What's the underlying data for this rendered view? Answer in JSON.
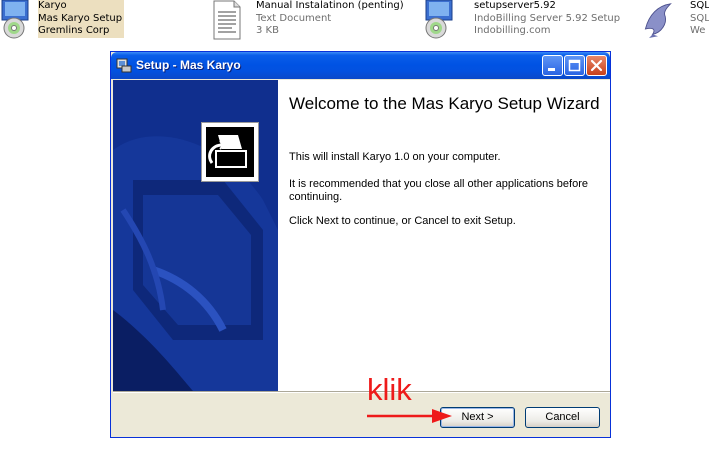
{
  "desktop": {
    "files": [
      {
        "name": "Karyo",
        "line2": "Mas Karyo Setup",
        "line3": "Gremlins Corp",
        "icon": "installer-cd-icon"
      },
      {
        "name": "Manual Instalatinon (penting)",
        "line2": "Text Document",
        "line3": "3 KB",
        "icon": "text-document-icon"
      },
      {
        "name": "setupserver5.92",
        "line2": "IndoBilling Server 5.92 Setup",
        "line3": "Indobilling.com",
        "icon": "installer-cd-icon"
      },
      {
        "name": "SQL",
        "line2": "SQL",
        "line3": "We",
        "icon": "dolphin-icon"
      }
    ]
  },
  "window": {
    "title": "Setup - Mas Karyo",
    "heading": "Welcome to the Mas Karyo Setup Wizard",
    "paragraphs": [
      "This will install Karyo 1.0 on your computer.",
      "It is recommended that you close all other applications before continuing.",
      "Click Next to continue, or Cancel to exit Setup."
    ],
    "buttons": {
      "next": "Next >",
      "cancel": "Cancel"
    }
  },
  "annotation": {
    "text": "klik",
    "color": "#ee1a1a"
  },
  "colors": {
    "titlebar": "#0053e4",
    "left_panel": "#0e2d8a",
    "dialog_bg": "#ece9d8"
  }
}
